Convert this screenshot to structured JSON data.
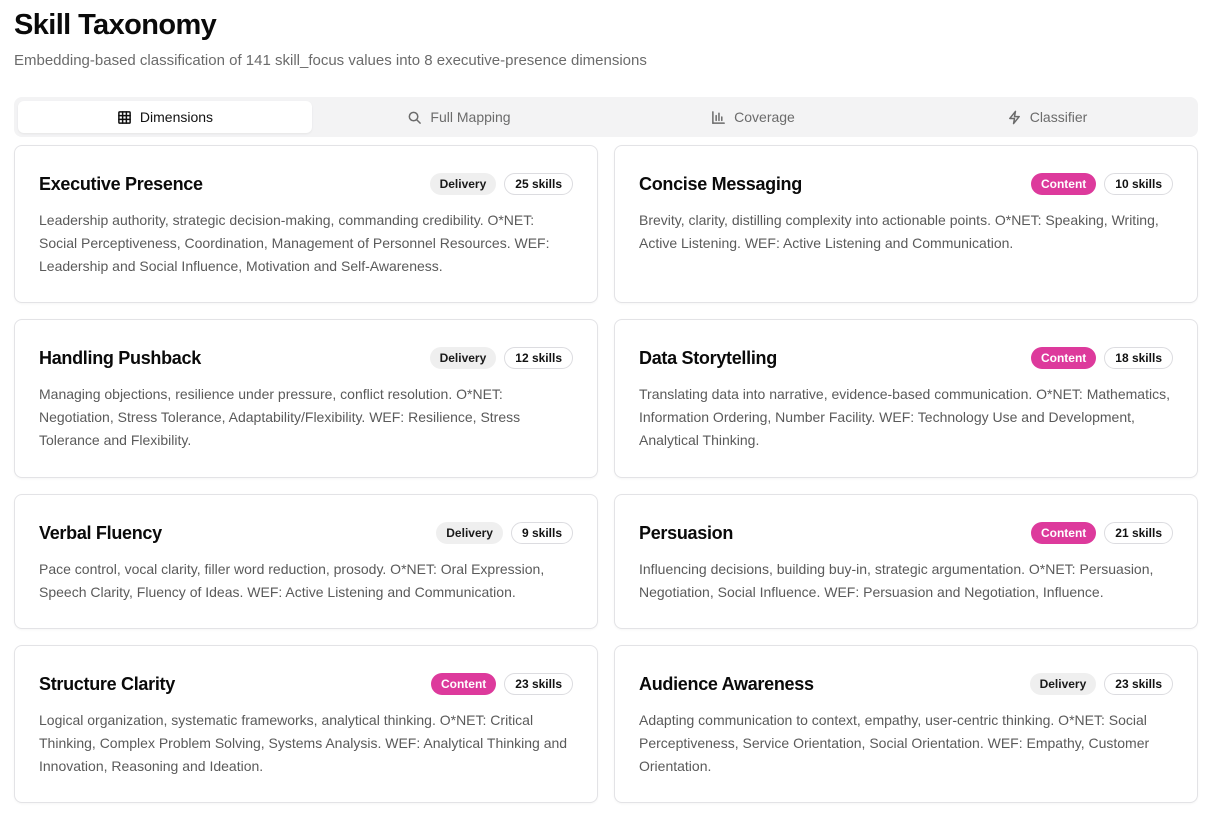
{
  "header": {
    "title": "Skill Taxonomy",
    "subtitle": "Embedding-based classification of 141 skill_focus values into 8 executive-presence dimensions"
  },
  "tabs": [
    {
      "label": "Dimensions",
      "icon": "table-icon",
      "active": true
    },
    {
      "label": "Full Mapping",
      "icon": "search-icon",
      "active": false
    },
    {
      "label": "Coverage",
      "icon": "bar-chart-icon",
      "active": false
    },
    {
      "label": "Classifier",
      "icon": "lightning-icon",
      "active": false
    }
  ],
  "colors": {
    "content_badge": "#dd3a9c",
    "delivery_badge": "#efefef"
  },
  "dimensions": [
    {
      "title": "Executive Presence",
      "type": "Delivery",
      "count": "25 skills",
      "description": "Leadership authority, strategic decision-making, commanding credibility. O*NET: Social Perceptiveness, Coordination, Management of Personnel Resources. WEF: Leadership and Social Influence, Motivation and Self-Awareness."
    },
    {
      "title": "Concise Messaging",
      "type": "Content",
      "count": "10 skills",
      "description": "Brevity, clarity, distilling complexity into actionable points. O*NET: Speaking, Writing, Active Listening. WEF: Active Listening and Communication."
    },
    {
      "title": "Handling Pushback",
      "type": "Delivery",
      "count": "12 skills",
      "description": "Managing objections, resilience under pressure, conflict resolution. O*NET: Negotiation, Stress Tolerance, Adaptability/Flexibility. WEF: Resilience, Stress Tolerance and Flexibility."
    },
    {
      "title": "Data Storytelling",
      "type": "Content",
      "count": "18 skills",
      "description": "Translating data into narrative, evidence-based communication. O*NET: Mathematics, Information Ordering, Number Facility. WEF: Technology Use and Development, Analytical Thinking."
    },
    {
      "title": "Verbal Fluency",
      "type": "Delivery",
      "count": "9 skills",
      "description": "Pace control, vocal clarity, filler word reduction, prosody. O*NET: Oral Expression, Speech Clarity, Fluency of Ideas. WEF: Active Listening and Communication."
    },
    {
      "title": "Persuasion",
      "type": "Content",
      "count": "21 skills",
      "description": "Influencing decisions, building buy-in, strategic argumentation. O*NET: Persuasion, Negotiation, Social Influence. WEF: Persuasion and Negotiation, Influence."
    },
    {
      "title": "Structure Clarity",
      "type": "Content",
      "count": "23 skills",
      "description": "Logical organization, systematic frameworks, analytical thinking. O*NET: Critical Thinking, Complex Problem Solving, Systems Analysis. WEF: Analytical Thinking and Innovation, Reasoning and Ideation."
    },
    {
      "title": "Audience Awareness",
      "type": "Delivery",
      "count": "23 skills",
      "description": "Adapting communication to context, empathy, user-centric thinking. O*NET: Social Perceptiveness, Service Orientation, Social Orientation. WEF: Empathy, Customer Orientation."
    }
  ]
}
